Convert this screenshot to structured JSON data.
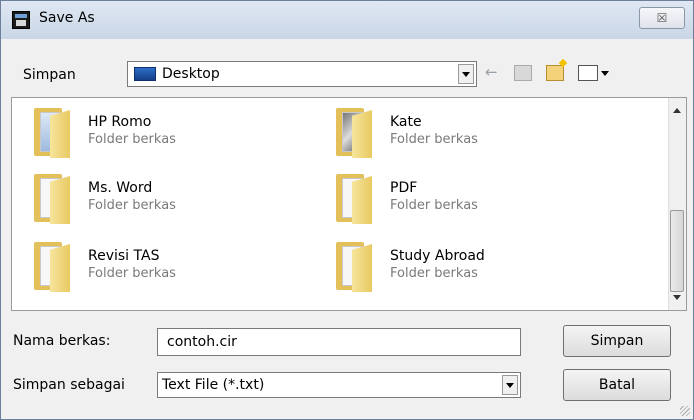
{
  "window": {
    "title": "Save As",
    "close_glyph": "☒"
  },
  "location": {
    "label": "Simpan",
    "value": "Desktop",
    "icon": "desktop-icon"
  },
  "toolbar": {
    "back_glyph": "←"
  },
  "files": {
    "items": [
      {
        "name": "HP Romo",
        "type": "Folder berkas",
        "icon": "folder-icon"
      },
      {
        "name": "Kate",
        "type": "Folder berkas",
        "icon": "folder-photo-icon"
      },
      {
        "name": "Ms. Word",
        "type": "Folder berkas",
        "icon": "folder-icon"
      },
      {
        "name": "PDF",
        "type": "Folder berkas",
        "icon": "folder-icon"
      },
      {
        "name": "Revisi TAS",
        "type": "Folder berkas",
        "icon": "folder-icon"
      },
      {
        "name": "Study Abroad",
        "type": "Folder berkas",
        "icon": "folder-icon"
      }
    ]
  },
  "filename": {
    "label": "Nama berkas:",
    "value": "contoh.cir"
  },
  "filetype": {
    "label": "Simpan sebagai",
    "value": "Text File (*.txt)"
  },
  "buttons": {
    "save": "Simpan",
    "cancel": "Batal"
  }
}
